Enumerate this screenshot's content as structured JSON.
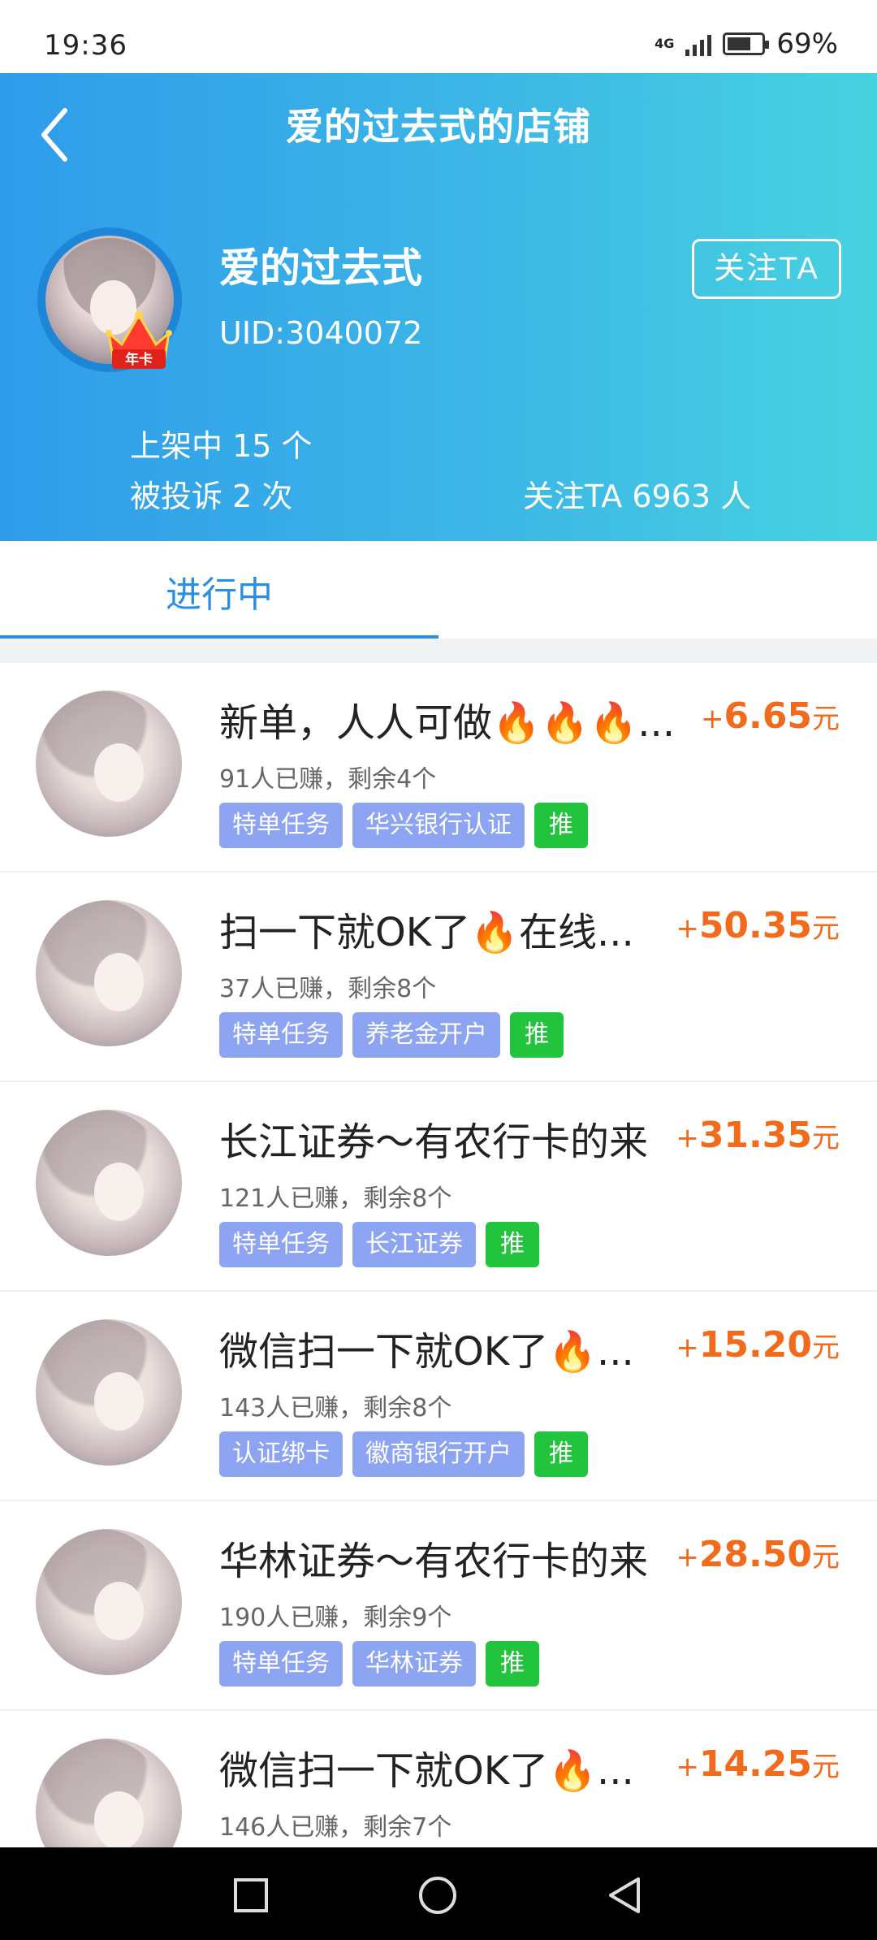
{
  "status": {
    "time": "19:36",
    "network": "4G",
    "battery": "69%",
    "battery_level": 0.69
  },
  "header": {
    "title": "爱的过去式的店铺",
    "username": "爱的过去式",
    "uid": "UID:3040072",
    "badge": "年卡",
    "follow_button": "关注TA",
    "listed": "上架中 15 个",
    "complaints": "被投诉 2 次",
    "followers": "关注TA 6963 人"
  },
  "tabs": [
    {
      "label": "进行中",
      "active": true
    }
  ],
  "items": [
    {
      "title": "新单，人人可做🔥🔥🔥...",
      "plus": "+",
      "amount": "6.65",
      "unit": "元",
      "meta": "91人已赚，剩余4个",
      "tags": [
        "特单任务",
        "华兴银行认证"
      ],
      "push": "推"
    },
    {
      "title": "扫一下就OK了🔥在线...",
      "plus": "+",
      "amount": "50.35",
      "unit": "元",
      "meta": "37人已赚，剩余8个",
      "tags": [
        "特单任务",
        "养老金开户"
      ],
      "push": "推"
    },
    {
      "title": "长江证券～有农行卡的来",
      "plus": "+",
      "amount": "31.35",
      "unit": "元",
      "meta": "121人已赚，剩余8个",
      "tags": [
        "特单任务",
        "长江证券"
      ],
      "push": "推"
    },
    {
      "title": "微信扫一下就OK了🔥...",
      "plus": "+",
      "amount": "15.20",
      "unit": "元",
      "meta": "143人已赚，剩余8个",
      "tags": [
        "认证绑卡",
        "徽商银行开户"
      ],
      "push": "推"
    },
    {
      "title": "华林证券～有农行卡的来",
      "plus": "+",
      "amount": "28.50",
      "unit": "元",
      "meta": "190人已赚，剩余9个",
      "tags": [
        "特单任务",
        "华林证券"
      ],
      "push": "推"
    },
    {
      "title": "微信扫一下就OK了🔥...",
      "plus": "+",
      "amount": "14.25",
      "unit": "元",
      "meta": "146人已赚，剩余7个",
      "tags": [],
      "push": ""
    }
  ],
  "colors": {
    "accent": "#2b8ee0",
    "price": "#f26a1b",
    "tag": "#8da4f2",
    "push": "#22c33d"
  }
}
